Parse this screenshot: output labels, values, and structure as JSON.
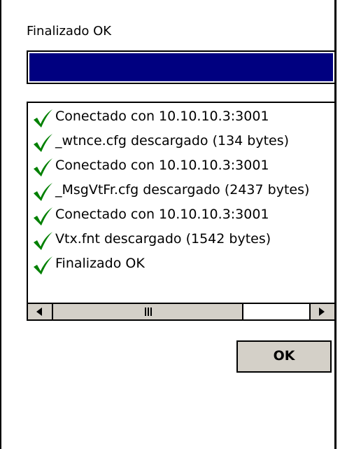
{
  "status_label": "Finalizado OK",
  "progress": {
    "percent": 100,
    "fill_color": "#000080"
  },
  "log": {
    "items": [
      {
        "icon": "check-icon",
        "text": "Conectado con 10.10.10.3:3001"
      },
      {
        "icon": "check-icon",
        "text": "_wtnce.cfg descargado (134 bytes)"
      },
      {
        "icon": "check-icon",
        "text": "Conectado con 10.10.10.3:3001"
      },
      {
        "icon": "check-icon",
        "text": "_MsgVtFr.cfg descargado (2437 bytes)"
      },
      {
        "icon": "check-icon",
        "text": "Conectado con 10.10.10.3:3001"
      },
      {
        "icon": "check-icon",
        "text": "Vtx.fnt descargado (1542 bytes)"
      },
      {
        "icon": "check-icon",
        "text": "Finalizado OK"
      }
    ],
    "check_color": "#008000"
  },
  "ok_button": {
    "label": "OK"
  }
}
